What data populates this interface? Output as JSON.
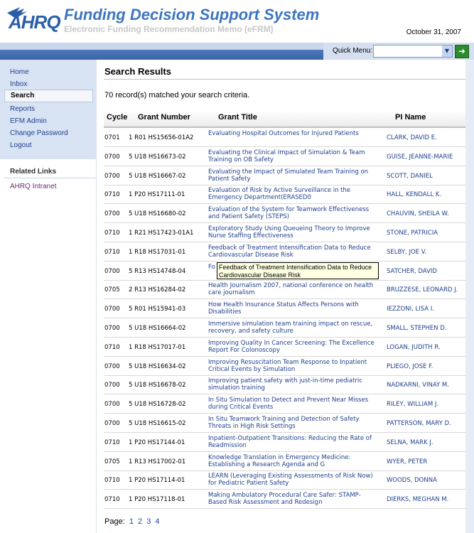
{
  "header": {
    "logo_text": "AHRQ",
    "title": "Funding Decision Support System",
    "subtitle": "Electronic Funding Recommendation Memo (eFRM)",
    "date": "October 31, 2007"
  },
  "quick_menu": {
    "label": "Quick Menu:",
    "selected": "",
    "arrow_icon": "chevron-down-icon",
    "go_icon": "arrow-right-icon"
  },
  "sidebar": {
    "items": [
      {
        "label": "Home"
      },
      {
        "label": "Inbox"
      },
      {
        "label": "Search"
      },
      {
        "label": "Reports"
      },
      {
        "label": "EFM Admin"
      },
      {
        "label": "Change Password"
      },
      {
        "label": "Logout"
      }
    ],
    "related_heading": "Related Links",
    "related_links": [
      {
        "label": "AHRQ Intranet"
      }
    ]
  },
  "main": {
    "title": "Search Results",
    "match_text": "70 record(s) matched your search criteria.",
    "columns": [
      "Cycle",
      "Grant Number",
      "Grant Title",
      "PI Name"
    ],
    "rows": [
      {
        "cycle": "0701",
        "grant": "1 R01 HS15656-01A2",
        "title": "Evaluating Hospital Outcomes for Injured Patients",
        "pi": "CLARK, DAVID E."
      },
      {
        "cycle": "0700",
        "grant": "5 U18 HS16673-02",
        "title": "Evaluating the Clinical Impact of Simulation & Team Training on OB Safety",
        "pi": "GUISE, JEANNE-MARIE"
      },
      {
        "cycle": "0700",
        "grant": "5 U18 HS16667-02",
        "title": "Evaluating the Impact of Simulated Team Training on Patient Safety",
        "pi": "SCOTT, DANIEL"
      },
      {
        "cycle": "0710",
        "grant": "1 P20 HS17111-01",
        "title": "Evaluation of Risk by Active Surveillance in the Emergency Department(ERASED0",
        "pi": "HALL, KENDALL K."
      },
      {
        "cycle": "0700",
        "grant": "5 U18 HS16680-02",
        "title": "Evaluation of the System for Teamwork Effectiveness and Patient Safety (STEPS)",
        "pi": "CHAUVIN, SHEILA W."
      },
      {
        "cycle": "0710",
        "grant": "1 R21 HS17423-01A1",
        "title": "Exploratory Study Using Queueing Theory to Improve Nurse Staffing Effectiveness",
        "pi": "STONE, PATRICIA"
      },
      {
        "cycle": "0710",
        "grant": "1 R18 HS17031-01",
        "title": "Feedback of Treatment Intensification Data to Reduce Cardiovascular Disease Risk",
        "pi": "SELBY, JOE V."
      },
      {
        "cycle": "0700",
        "grant": "5 R13 HS14748-04",
        "title": "Fo Co",
        "pi": "SATCHER, DAVID"
      },
      {
        "cycle": "0705",
        "grant": "2 R13 HS16284-02",
        "title": "Health Journalism 2007, national conference on health care journalism",
        "pi": "BRUZZESE, LEONARD J."
      },
      {
        "cycle": "0700",
        "grant": "5 R01 HS15941-03",
        "title": "How Health Insurance Status Affects Persons with Disabilities",
        "pi": "IEZZONI, LISA I."
      },
      {
        "cycle": "0700",
        "grant": "5 U18 HS16664-02",
        "title": "Immersive simulation team training impact on rescue, recovery, and safety culture",
        "pi": "SMALL, STEPHEN D."
      },
      {
        "cycle": "0710",
        "grant": "1 R18 HS17017-01",
        "title": "Improving Quality In Cancer Screening: The Excellence Report For Colonoscopy",
        "pi": "LOGAN, JUDITH R."
      },
      {
        "cycle": "0700",
        "grant": "5 U18 HS16634-02",
        "title": "Improving Resuscitation Team Response to Inpatient Critical Events by Simulation",
        "pi": "PLIEGO, JOSE F."
      },
      {
        "cycle": "0700",
        "grant": "5 U18 HS16678-02",
        "title": "Improving patient safety with just-in-time pediatric simulation training",
        "pi": "NADKARNI, VINAY M."
      },
      {
        "cycle": "0700",
        "grant": "5 U18 HS16728-02",
        "title": "In Situ Simulation to Detect and Prevent Near Misses during Critical Events",
        "pi": "RILEY, WILLIAM J."
      },
      {
        "cycle": "0700",
        "grant": "5 U18 HS16615-02",
        "title": "In Situ Teamwork Training and Detection of Safety Threats in High Risk Settings",
        "pi": "PATTERSON, MARY D."
      },
      {
        "cycle": "0710",
        "grant": "1 P20 HS17144-01",
        "title": "Inpatient-Outpatient Transitions: Reducing the Rate of Readmission",
        "pi": "SELNA, MARK J."
      },
      {
        "cycle": "0705",
        "grant": "1 R13 HS17002-01",
        "title": "Knowledge Translation in Emergency Medicine: Establishing a Research Agenda and G",
        "pi": "WYER, PETER"
      },
      {
        "cycle": "0710",
        "grant": "1 P20 HS17114-01",
        "title": "LEARN (Leveraging Existing Assessments of Risk Now) for Pediatric Patient Safety",
        "pi": "WOODS, DONNA"
      },
      {
        "cycle": "0710",
        "grant": "1 P20 HS17118-01",
        "title": "Making Ambulatory Procedural Care Safer: STAMP-Based Risk Assessment and Redesign",
        "pi": "DIERKS, MEGHAN M."
      }
    ],
    "tooltip": "Feedback of Treatment Intensification Data to Reduce Cardiovascular Disease Risk",
    "pager": {
      "label": "Page:",
      "pages": [
        "1",
        "2",
        "3",
        "4"
      ]
    }
  }
}
